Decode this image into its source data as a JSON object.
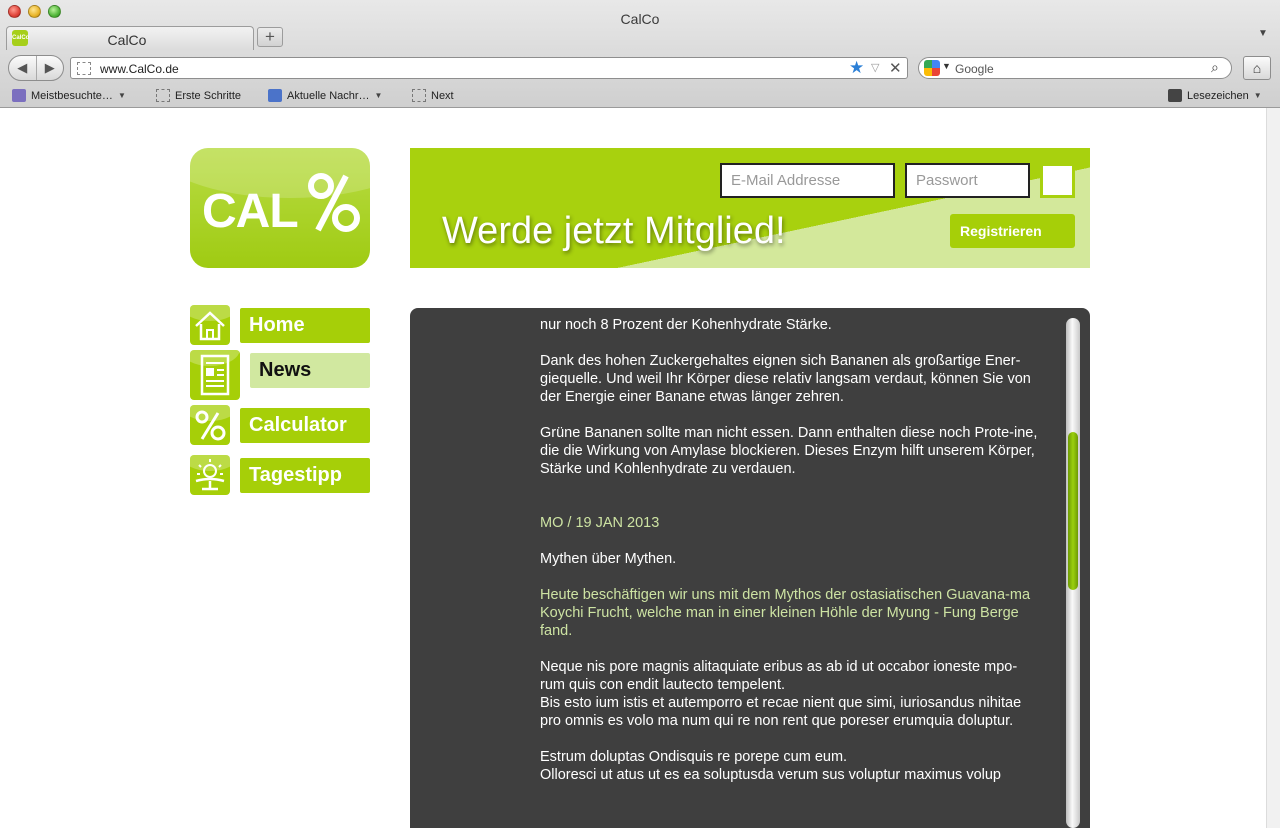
{
  "browser": {
    "window_title": "CalCo",
    "tab_title": "CalCo",
    "tab_favicon_text": "CalCo",
    "new_tab_symbol": "+",
    "url": "www.CalCo.de",
    "search_placeholder": "Google",
    "icons": [
      "back-icon",
      "forward-icon",
      "bookmark-star-icon",
      "close-icon",
      "search-icon",
      "home-icon",
      "rss-icon"
    ],
    "bookmarks": [
      {
        "label": "Meistbesuchte…",
        "has_menu": true
      },
      {
        "label": "Erste Schritte",
        "has_menu": false
      },
      {
        "label": "Aktuelle Nachr…",
        "has_menu": true
      },
      {
        "label": "Next",
        "has_menu": false
      }
    ],
    "bookmarks_menu": "Lesezeichen"
  },
  "site": {
    "logo_text": "CAL",
    "logo_superscript": "%",
    "header": {
      "title": "Werde jetzt Mitglied!",
      "email_placeholder": "E-Mail Addresse",
      "password_placeholder": "Passwort",
      "register_label": "Registrieren"
    },
    "nav": [
      {
        "label": "Home",
        "icon": "house-icon",
        "active": false
      },
      {
        "label": "News",
        "icon": "newspaper-icon",
        "active": true
      },
      {
        "label": "Calculator",
        "icon": "percent-icon",
        "active": false
      },
      {
        "label": "Tagestipp",
        "icon": "sun-icon",
        "active": false
      }
    ],
    "content": {
      "p1": "nur noch 8 Prozent der Kohenhydrate Stärke.",
      "p2": "Dank des hohen Zuckergehaltes eignen sich Bananen als großartige Ener-giequelle. Und weil Ihr Körper diese relativ langsam verdaut, können Sie von der Energie einer Banane etwas länger zehren.",
      "p3": "Grüne Bananen sollte man nicht essen. Dann enthalten diese noch Prote-ine, die die Wirkung von Amylase blockieren. Dieses Enzym hilft unserem Körper, Stärke und Kohlenhydrate zu verdauen.",
      "date": "MO / 19 JAN 2013",
      "headline": "Mythen über Mythen.",
      "teaser": "Heute beschäftigen wir uns mit dem Mythos der ostasiatischen Guavana-ma Koychi Frucht, welche man in einer kleinen Höhle der Myung - Fung Berge fand.",
      "p4a": "Neque nis pore magnis alitaquiate eribus as ab id ut occabor ioneste mpo-rum quis con endit lautecto tempelent.",
      "p4b": "Bis esto ium istis et autemporro et recae nient que simi, iuriosandus nihitae pro omnis es volo ma num qui re non rent que poreser erumquia doluptur.",
      "p5a": "Estrum doluptas Ondisquis re porepe cum eum.",
      "p5b": "Olloresci ut atus ut es ea soluptusda verum sus voluptur maximus volup"
    }
  },
  "colors": {
    "brand_green": "#a6cf08",
    "light_green": "#d1e8a0",
    "content_bg": "#3f3f3f",
    "accent_text": "#cde3a3"
  }
}
